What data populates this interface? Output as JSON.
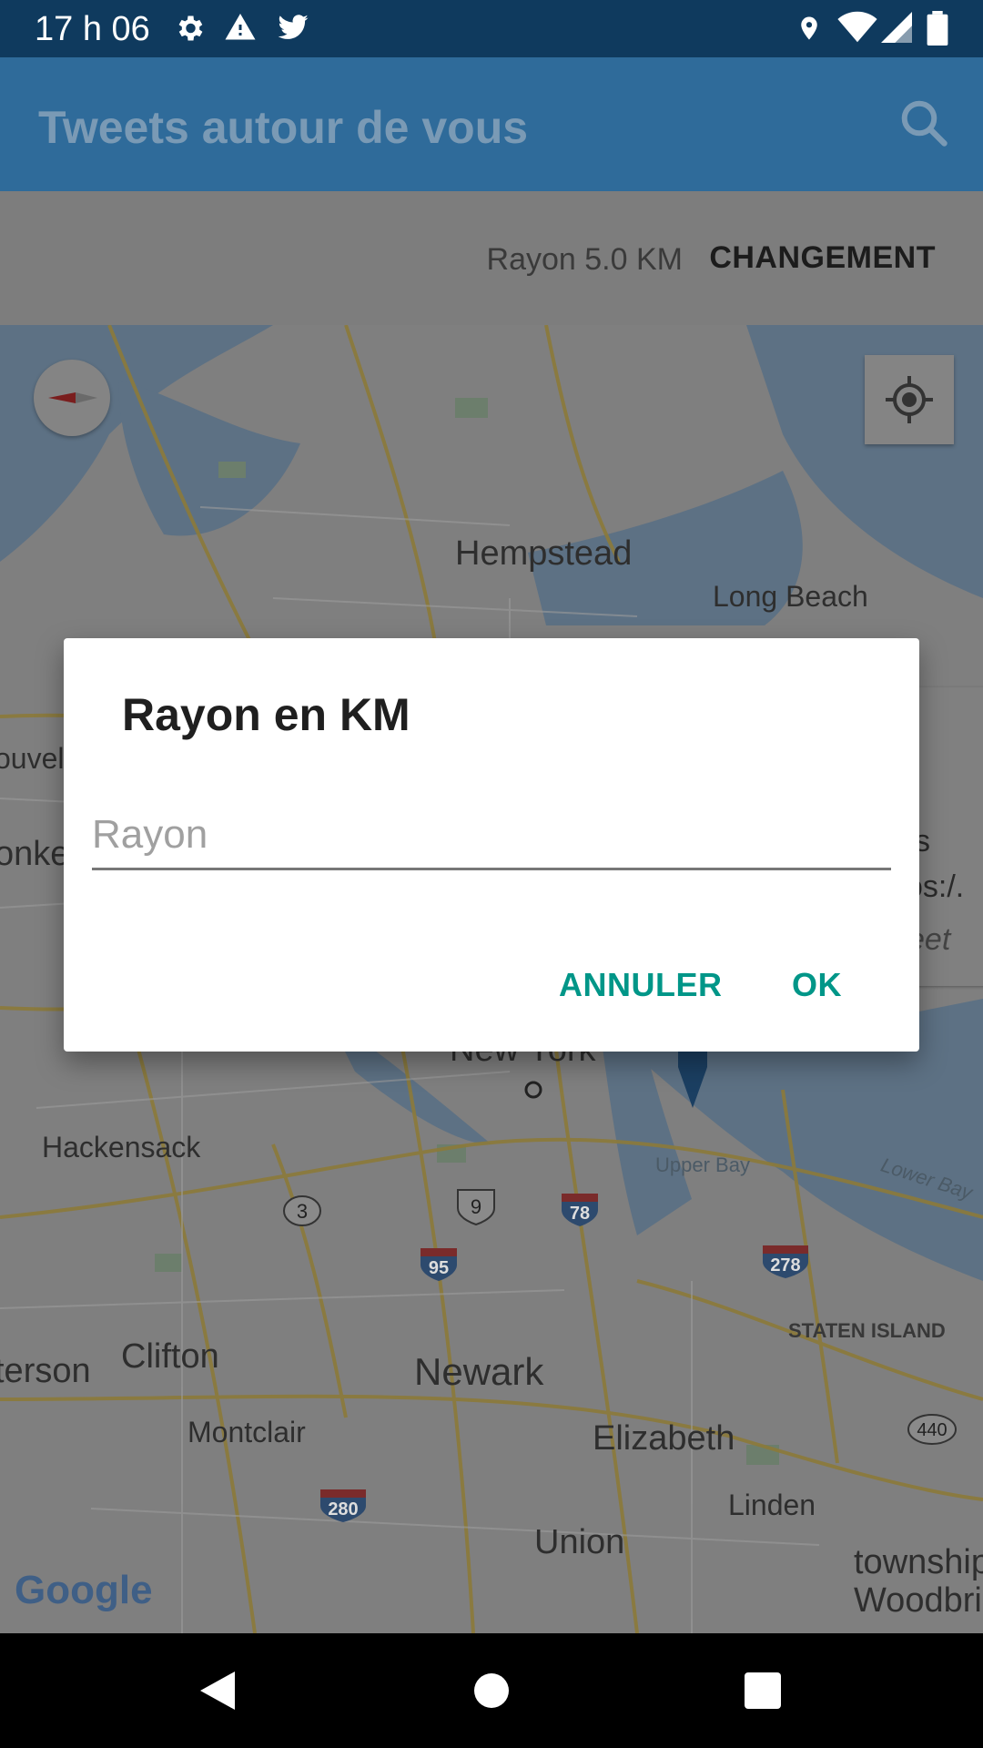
{
  "status_bar": {
    "time": "17 h 06",
    "icons": [
      "gear-icon",
      "warning-icon",
      "twitter-icon",
      "location-icon",
      "wifi-icon",
      "signal-icon",
      "battery-icon"
    ]
  },
  "app_bar": {
    "title": "Tweets autour de vous",
    "search_icon": "search-icon"
  },
  "radius_bar": {
    "label": "Rayon 5.0 KM",
    "change_label": "CHANGEMENT"
  },
  "map": {
    "labels": {
      "hempstead": "Hempstead",
      "long_beach": "Long Beach",
      "new_york": "New York",
      "hackensack": "Hackensack",
      "upper_bay": "Upper Bay",
      "lower_bay": "Lower Bay",
      "staten_island": "STATEN ISLAND",
      "clifton": "Clifton",
      "newark": "Newark",
      "elizabeth": "Elizabeth",
      "montclair": "Montclair",
      "linden": "Linden",
      "union": "Union",
      "paterson": "terson",
      "township": "township",
      "woodbridge": "Woodbric",
      "nouvel": "ouvel",
      "yonkers": "onke"
    },
    "shields": {
      "r3": "3",
      "us9": "9",
      "i78": "78",
      "i95": "95",
      "i278": "278",
      "r440": "440",
      "i280": "280"
    },
    "info_window": {
      "line1": "s",
      "line2": "os:/.",
      "line3": "eet"
    },
    "google_logo": "Google",
    "colors": {
      "water": "#5d7184",
      "land": "#7f7f7f",
      "roads": "#8c7a3a"
    }
  },
  "dialog": {
    "title": "Rayon en KM",
    "input_placeholder": "Rayon",
    "input_value": "",
    "cancel_label": "ANNULER",
    "ok_label": "OK",
    "accent_color": "#009688"
  },
  "nav_bar": {
    "icons": [
      "back-icon",
      "home-icon",
      "recents-icon"
    ]
  }
}
